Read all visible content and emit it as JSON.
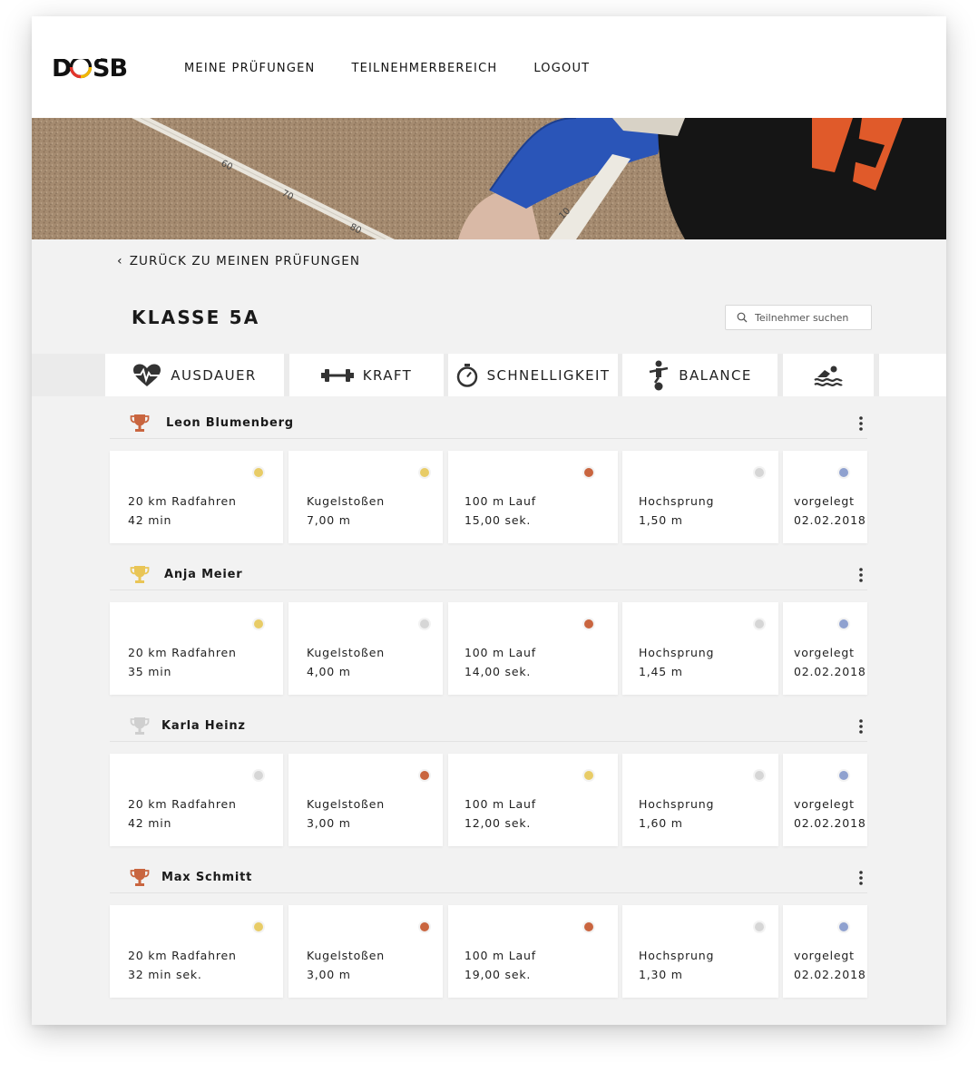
{
  "brand": {
    "logo_text": "DOSB"
  },
  "nav": [
    {
      "label": "MEINE PRÜFUNGEN"
    },
    {
      "label": "TEILNEHMERBEREICH"
    },
    {
      "label": "LOGOUT"
    }
  ],
  "hero": {
    "tape_marks": [
      "60",
      "70",
      "80",
      "10"
    ]
  },
  "back_link": "ZURÜCK ZU MEINEN PRÜFUNGEN",
  "page_title": "KLASSE 5A",
  "search": {
    "placeholder": "Teilnehmer suchen",
    "value": ""
  },
  "tabs": [
    {
      "label": "AUSDAUER",
      "icon": "heartbeat-icon"
    },
    {
      "label": "KRAFT",
      "icon": "dumbbell-icon"
    },
    {
      "label": "SCHNELLIGKEIT",
      "icon": "stopwatch-icon"
    },
    {
      "label": "BALANCE",
      "icon": "balance-icon"
    },
    {
      "label": "",
      "icon": "swimmer-icon"
    }
  ],
  "colors": {
    "gold": "#e8cc67",
    "bronze": "#c9653f",
    "silver": "#d6d6d6",
    "blue": "#8fa1cf",
    "trophy_bronze": "#c9653f",
    "trophy_gold": "#e9c556",
    "trophy_silver": "#cfcfcf"
  },
  "participants": [
    {
      "name": "Leon Blumenberg",
      "trophy": "bronze",
      "results": [
        {
          "label": "20 km Radfahren",
          "value": "42 min",
          "medal": "gold"
        },
        {
          "label": "Kugelstoßen",
          "value": "7,00 m",
          "medal": "gold"
        },
        {
          "label": "100 m Lauf",
          "value": "15,00 sek.",
          "medal": "bronze"
        },
        {
          "label": "Hochsprung",
          "value": "1,50 m",
          "medal": "silver"
        },
        {
          "label": "vorgelegt",
          "value": "02.02.2018",
          "medal": "blue"
        }
      ]
    },
    {
      "name": "Anja Meier",
      "trophy": "gold",
      "results": [
        {
          "label": "20 km Radfahren",
          "value": "35 min",
          "medal": "gold"
        },
        {
          "label": "Kugelstoßen",
          "value": "4,00 m",
          "medal": "silver"
        },
        {
          "label": "100 m Lauf",
          "value": "14,00 sek.",
          "medal": "bronze"
        },
        {
          "label": "Hochsprung",
          "value": "1,45 m",
          "medal": "silver"
        },
        {
          "label": "vorgelegt",
          "value": "02.02.2018",
          "medal": "blue"
        }
      ]
    },
    {
      "name": "Karla Heinz",
      "trophy": "silver",
      "results": [
        {
          "label": "20 km Radfahren",
          "value": "42 min",
          "medal": "silver"
        },
        {
          "label": "Kugelstoßen",
          "value": "3,00 m",
          "medal": "bronze"
        },
        {
          "label": "100 m Lauf",
          "value": "12,00 sek.",
          "medal": "gold"
        },
        {
          "label": "Hochsprung",
          "value": "1,60 m",
          "medal": "silver"
        },
        {
          "label": "vorgelegt",
          "value": "02.02.2018",
          "medal": "blue"
        }
      ]
    },
    {
      "name": "Max Schmitt",
      "trophy": "bronze",
      "results": [
        {
          "label": "20 km Radfahren",
          "value": "32 min sek.",
          "medal": "gold"
        },
        {
          "label": "Kugelstoßen",
          "value": "3,00 m",
          "medal": "bronze"
        },
        {
          "label": "100 m Lauf",
          "value": "19,00 sek.",
          "medal": "bronze"
        },
        {
          "label": "Hochsprung",
          "value": "1,30 m",
          "medal": "silver"
        },
        {
          "label": "vorgelegt",
          "value": "02.02.2018",
          "medal": "blue"
        }
      ]
    }
  ]
}
